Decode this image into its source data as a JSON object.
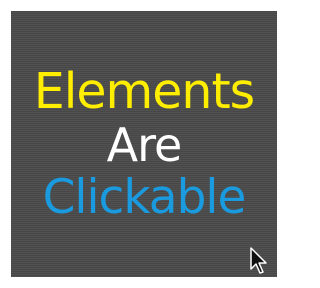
{
  "lines": [
    {
      "text": "Elements",
      "color": "#ffee00"
    },
    {
      "text": "Are",
      "color": "#ffffff"
    },
    {
      "text": "Clickable",
      "color": "#1a9be0"
    }
  ],
  "background_color": "#4a4a4a",
  "cursor_icon": "mouse-pointer-icon"
}
